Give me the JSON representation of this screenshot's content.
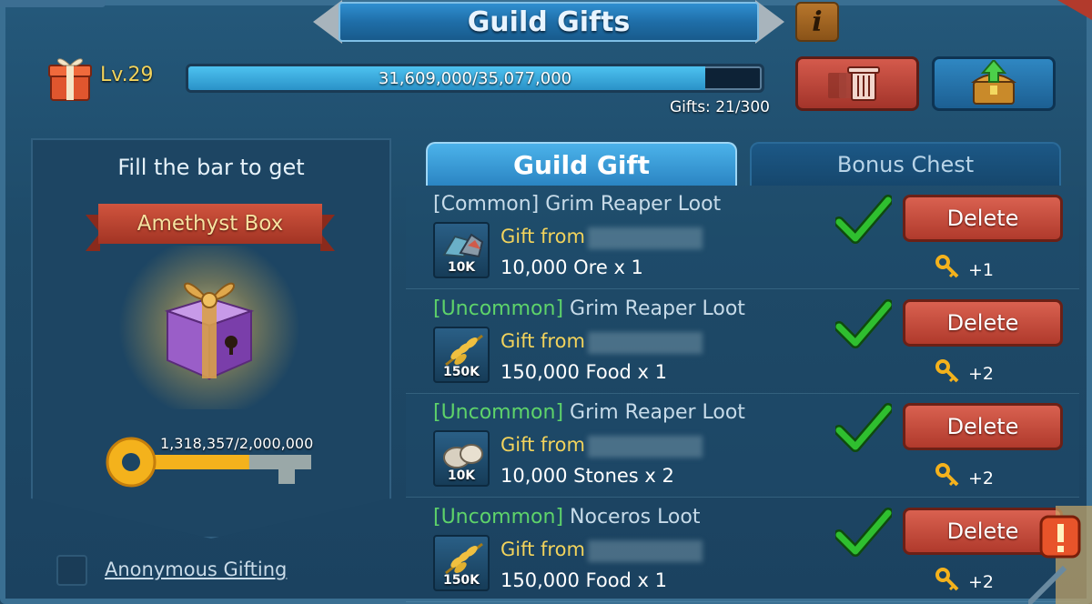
{
  "header": {
    "title": "Guild Gifts",
    "info_label": "i",
    "level": "Lv.29",
    "progress_text": "31,609,000/35,077,000",
    "progress_fraction": 0.901,
    "gifts_count": "Gifts: 21/300"
  },
  "left_panel": {
    "fill_text": "Fill the bar to get",
    "reward_name": "Amethyst Box",
    "key_progress_text": "1,318,357/2,000,000",
    "key_progress_fraction": 0.659,
    "anonymous_label": "Anonymous Gifting",
    "anonymous_checked": false
  },
  "tabs": [
    {
      "label": "Guild Gift",
      "active": true
    },
    {
      "label": "Bonus Chest",
      "active": false
    }
  ],
  "gifts": [
    {
      "rarity": "[Common]",
      "rarity_class": "common",
      "name": " Grim Reaper Loot",
      "from": "Gift from",
      "icon": "ore-icon",
      "qty": "10K",
      "reward": "10,000 Ore x 1",
      "key_bonus": "+1",
      "delete_label": "Delete"
    },
    {
      "rarity": "[Uncommon]",
      "rarity_class": "uncommon",
      "name": " Grim Reaper Loot",
      "from": "Gift from",
      "icon": "food-icon",
      "qty": "150K",
      "reward": "150,000 Food x 1",
      "key_bonus": "+2",
      "delete_label": "Delete"
    },
    {
      "rarity": "[Uncommon]",
      "rarity_class": "uncommon",
      "name": " Grim Reaper Loot",
      "from": "Gift from",
      "icon": "stone-icon",
      "qty": "10K",
      "reward": "10,000 Stones x 2",
      "key_bonus": "+2",
      "delete_label": "Delete"
    },
    {
      "rarity": "[Uncommon]",
      "rarity_class": "uncommon",
      "name": " Noceros Loot",
      "from": "Gift from",
      "icon": "food-icon",
      "qty": "150K",
      "reward": "150,000 Food x 1",
      "key_bonus": "+2",
      "delete_label": "Delete"
    }
  ],
  "colors": {
    "accent_blue": "#2b85c3",
    "delete_red": "#b03a2c",
    "gold_text": "#f2d35c",
    "uncommon_green": "#5ed36a",
    "check_green": "#2fbf2f"
  }
}
